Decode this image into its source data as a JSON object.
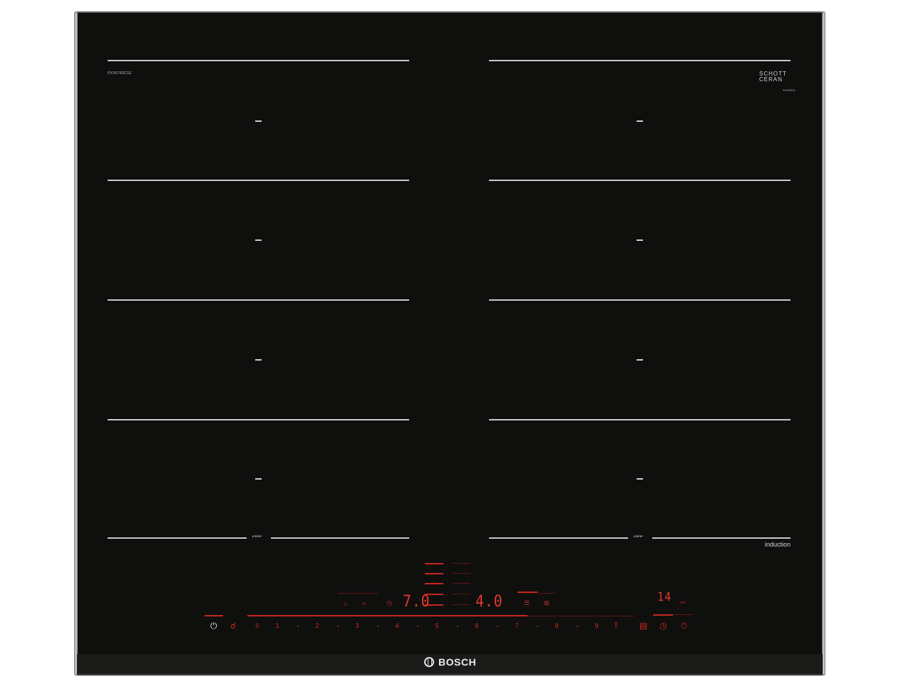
{
  "brand": {
    "logo_text": "BOSCH"
  },
  "model_label": "PXX675DC1E",
  "glass_brand": {
    "line1": "SCHOTT",
    "line2": "CERAN",
    "subtext": "90002891"
  },
  "induction_label": "induction",
  "zones": {
    "left": {
      "flex_symbol": "⌐⌐⌐"
    },
    "right": {
      "flex_symbol": "⌐⌐⌐"
    }
  },
  "display": {
    "left_power_value": "7.0",
    "right_power_value": "4.0",
    "timer_value": "14",
    "timer_unit": "min"
  },
  "power_scale": [
    "0",
    "1",
    "2",
    "3",
    "4",
    "5",
    "6",
    "7",
    "8",
    "9"
  ],
  "icons": {
    "power": "power-icon",
    "child_lock": "child-lock-icon",
    "boost": "boost-icon",
    "move": "move-icon",
    "timer": "timer-icon",
    "stopwatch": "stopwatch-icon",
    "menu": "menu-icon",
    "frying": "frying-sensor-icon"
  },
  "colors": {
    "glass": "#0f0f0e",
    "display_red": "#d42a22",
    "frame": "#9a9a9a"
  }
}
